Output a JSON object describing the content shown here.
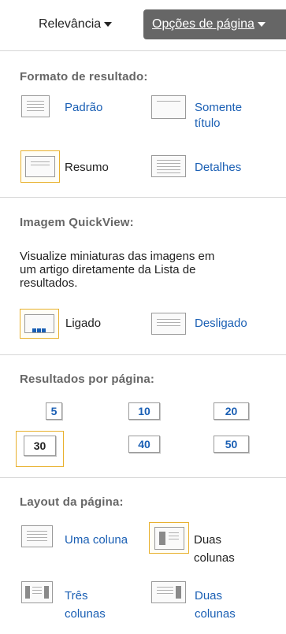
{
  "header": {
    "sort_label": "Relevância",
    "page_options_label": "Opções de página"
  },
  "result_format": {
    "title": "Formato de resultado:",
    "options": [
      {
        "line1": "Padrão",
        "line2": ""
      },
      {
        "line1": "Somente",
        "line2": "título"
      },
      {
        "line1": "Resumo",
        "line2": ""
      },
      {
        "line1": "Detalhes",
        "line2": ""
      }
    ],
    "selected": "Resumo"
  },
  "quickview": {
    "title": "Imagem QuickView:",
    "description_lines": [
      "Visualize miniaturas das imagens em",
      "um artigo diretamente da Lista de",
      "resultados."
    ],
    "on_label": "Ligado",
    "off_label": "Desligado",
    "selected": "Ligado"
  },
  "per_page": {
    "title": "Resultados por página:",
    "values": [
      "5",
      "10",
      "20",
      "30",
      "40",
      "50"
    ],
    "selected": "30"
  },
  "layout": {
    "title": "Layout da página:",
    "options": [
      {
        "line1": "Uma coluna",
        "line2": ""
      },
      {
        "line1": "Duas",
        "line2": "colunas"
      },
      {
        "line1": "Três",
        "line2": "colunas"
      },
      {
        "line1": "Duas",
        "line2": "colunas"
      }
    ],
    "selected": "Duas colunas"
  },
  "colors": {
    "link": "#1a5fb4",
    "selected_border": "#e8b02c",
    "header_button_bg": "#666666",
    "section_title": "#666666"
  }
}
